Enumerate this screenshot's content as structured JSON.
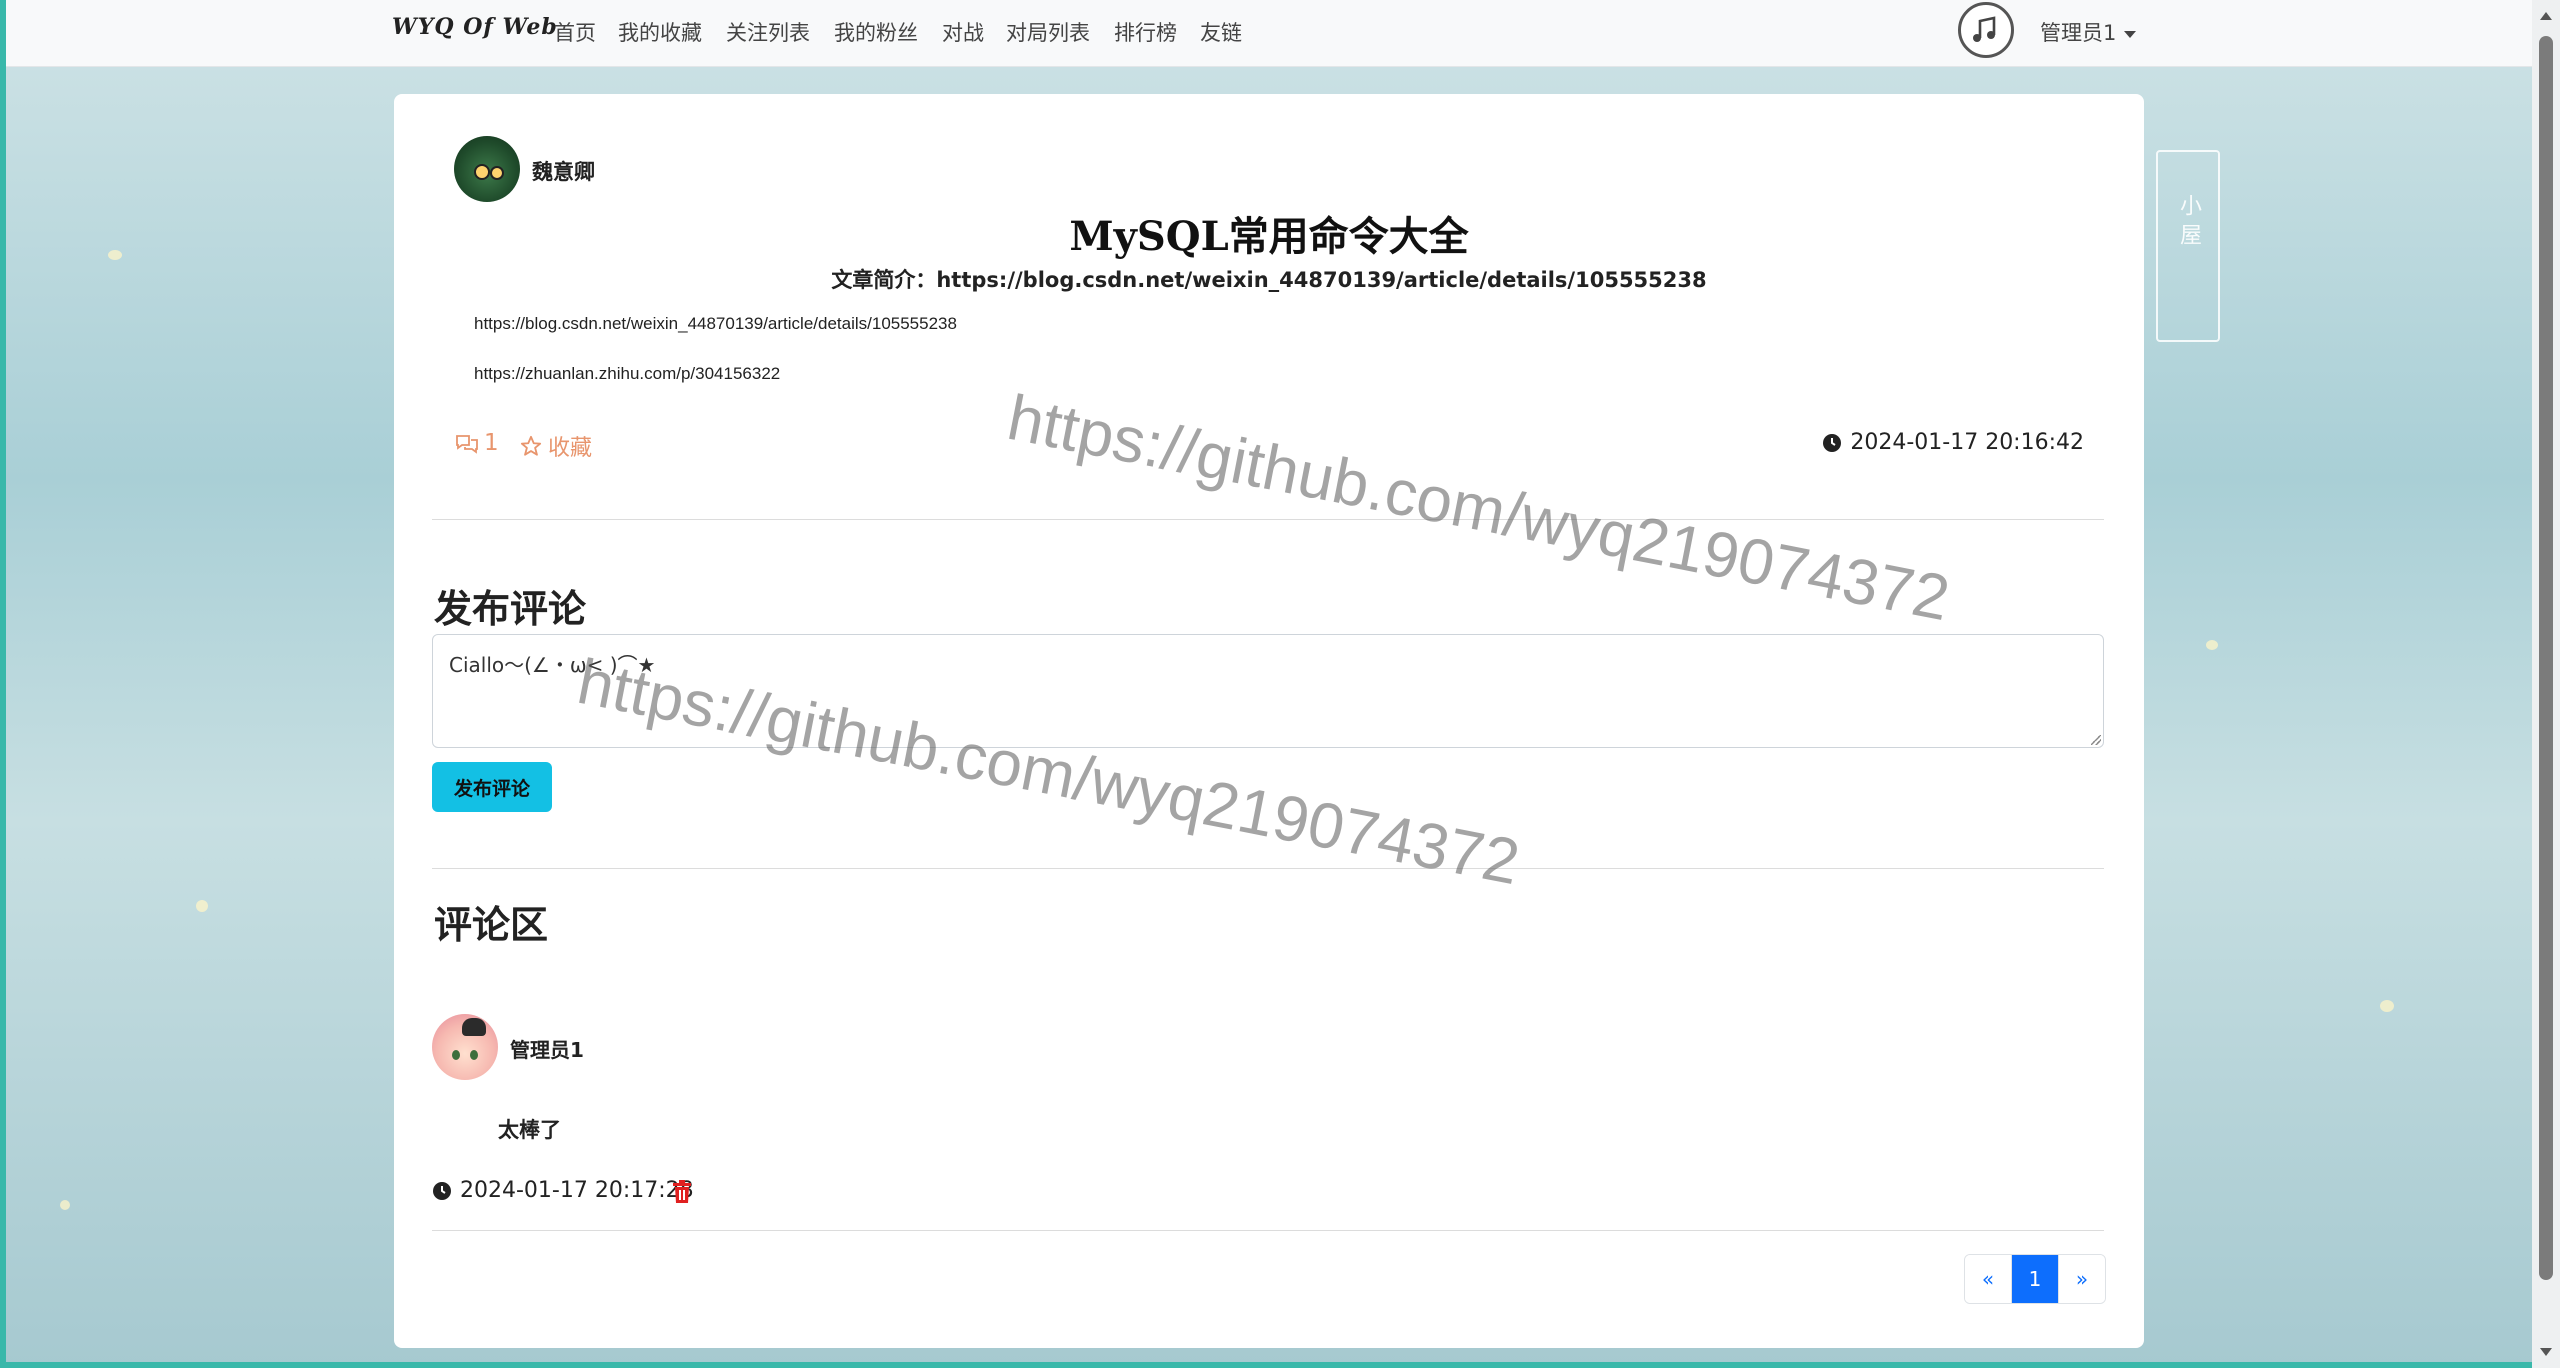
{
  "nav": {
    "brand": "WYQ Of Web",
    "links": [
      "首页",
      "我的收藏",
      "关注列表",
      "我的粉丝",
      "对战",
      "对局列表",
      "排行榜",
      "友链"
    ],
    "user": "管理员1"
  },
  "post": {
    "author": "魏意卿",
    "title": "MySQL常用命令大全",
    "intro": "文章简介：https://blog.csdn.net/weixin_44870139/article/details/105555238",
    "links": [
      "https://blog.csdn.net/weixin_44870139/article/details/105555238",
      "https://zhuanlan.zhihu.com/p/304156322"
    ],
    "comment_count": "1",
    "favorite_label": "收藏",
    "time": "2024-01-17 20:16:42"
  },
  "comment_form": {
    "heading": "发布评论",
    "value": "Ciallo～(∠・ω< )⌒★",
    "submit_label": "发布评论"
  },
  "comments": {
    "heading": "评论区",
    "items": [
      {
        "user": "管理员1",
        "content": "太棒了",
        "time": "2024-01-17 20:17:28"
      }
    ]
  },
  "pagination": {
    "prev": "«",
    "current": "1",
    "next": "»"
  },
  "watermark": "https://github.com/wyq219074372",
  "colors": {
    "accent": "#13c0e4",
    "stat": "#e8956d",
    "page_active": "#0d6efd",
    "delete": "#e02020"
  }
}
